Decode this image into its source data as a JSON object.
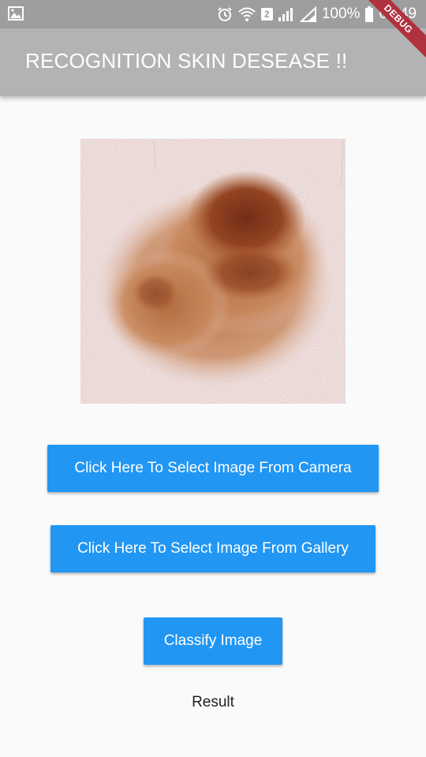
{
  "status_bar": {
    "battery": "100%",
    "time": "01:49",
    "sim_badge": "2",
    "icons": [
      "image-icon",
      "alarm-icon",
      "wifi-icon",
      "signal-icon",
      "battery-icon"
    ]
  },
  "app_bar": {
    "title": "RECOGNITION SKIN DESEASE !!",
    "debug_label": "DEBUG",
    "color": "#b3b3b3"
  },
  "main": {
    "image": "skin-lesion-photo",
    "camera_button": "Click Here To Select Image From Camera",
    "gallery_button": "Click Here To Select Image From Gallery",
    "classify_button": "Classify Image",
    "result_label": "Result",
    "button_color": "#2196f3"
  }
}
